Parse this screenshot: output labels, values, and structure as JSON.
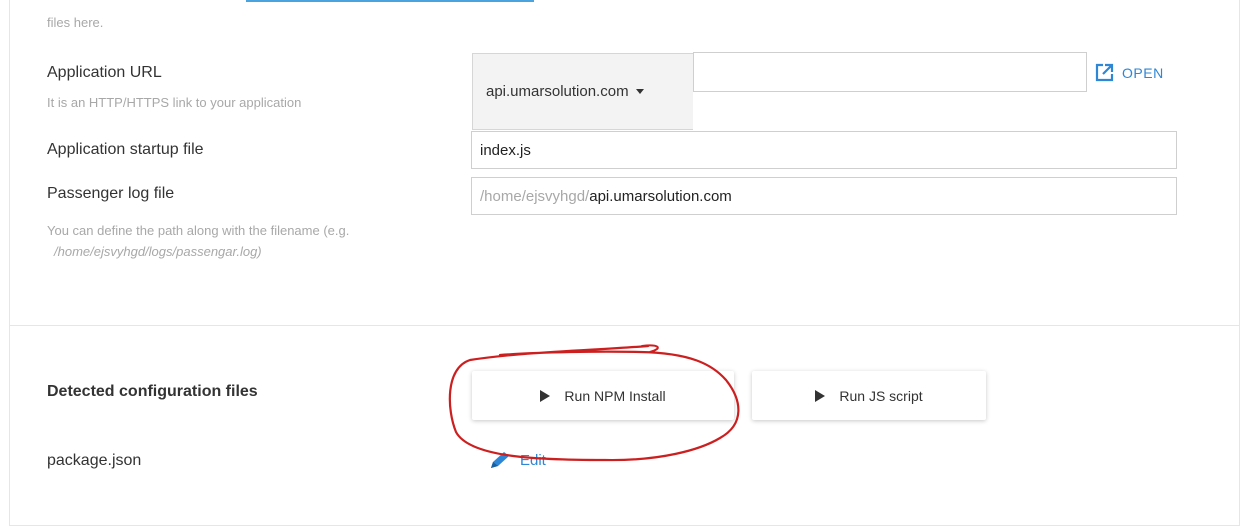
{
  "top_hint": "files here.",
  "application_url": {
    "label": "Application URL",
    "hint": "It is an HTTP/HTTPS link to your application",
    "domain": "api.umarsolution.com",
    "path_value": "",
    "open_label": "OPEN"
  },
  "startup_file": {
    "label": "Application startup file",
    "value": "index.js"
  },
  "passenger_log": {
    "label": "Passenger log file",
    "hint_line1": "You can define the path along with the filename (e.g.",
    "hint_line2": "/home/ejsvyhgd/logs/passengar.log)",
    "prefix": "/home/ejsvyhgd/",
    "value": "api.umarsolution.com"
  },
  "config": {
    "label": "Detected configuration files",
    "run_npm_label": "Run NPM Install",
    "run_js_label": "Run JS script",
    "file_name": "package.json",
    "edit_label": "Edit"
  },
  "colors": {
    "link": "#2e86d6",
    "annotation": "#cc1f1f"
  }
}
